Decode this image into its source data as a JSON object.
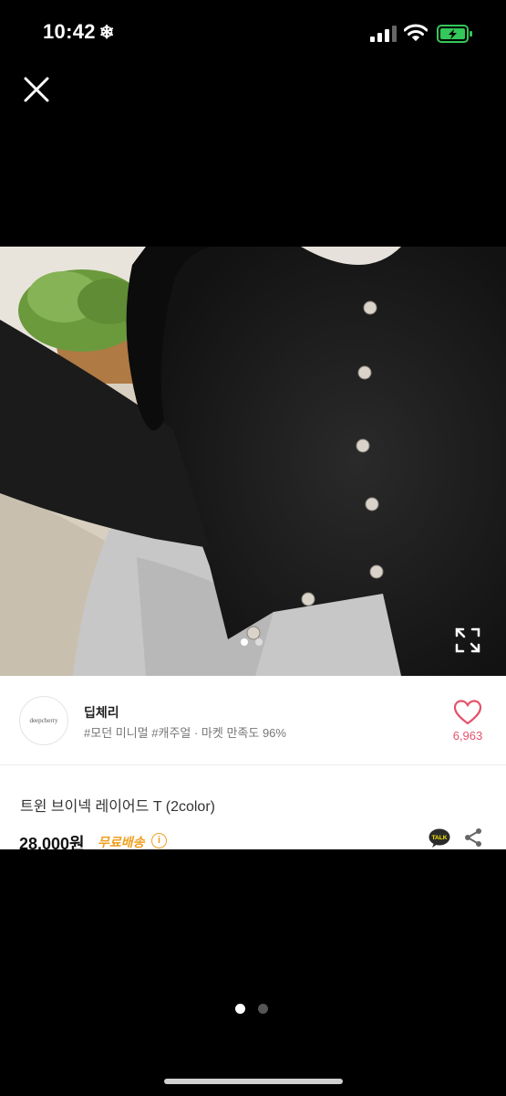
{
  "status_bar": {
    "time": "10:42",
    "time_icon": "snowflake-icon",
    "icons": [
      "cellular-signal-icon",
      "wifi-icon",
      "battery-charging-icon"
    ],
    "battery_color": "#34c759"
  },
  "viewer": {
    "close_icon": "close-icon",
    "photo": {
      "image_index": 1,
      "image_count": 2
    },
    "fullscreen_icon": "expand-icon"
  },
  "store": {
    "avatar_text": "deepcherry",
    "name": "딥체리",
    "tags": "#모던 미니멀 #캐주얼 · 마켓 만족도 96%",
    "like_count": "6,963",
    "accent_color": "#e5526b"
  },
  "product": {
    "title": "트윈 브이넥 레이어드 T (2color)",
    "price": "28,000원",
    "shipping": "무료배송",
    "talk_icon": "kakaotalk-icon",
    "talk_label": "TALK",
    "share_icon": "share-icon"
  },
  "pager": {
    "current": 1,
    "total": 2
  }
}
